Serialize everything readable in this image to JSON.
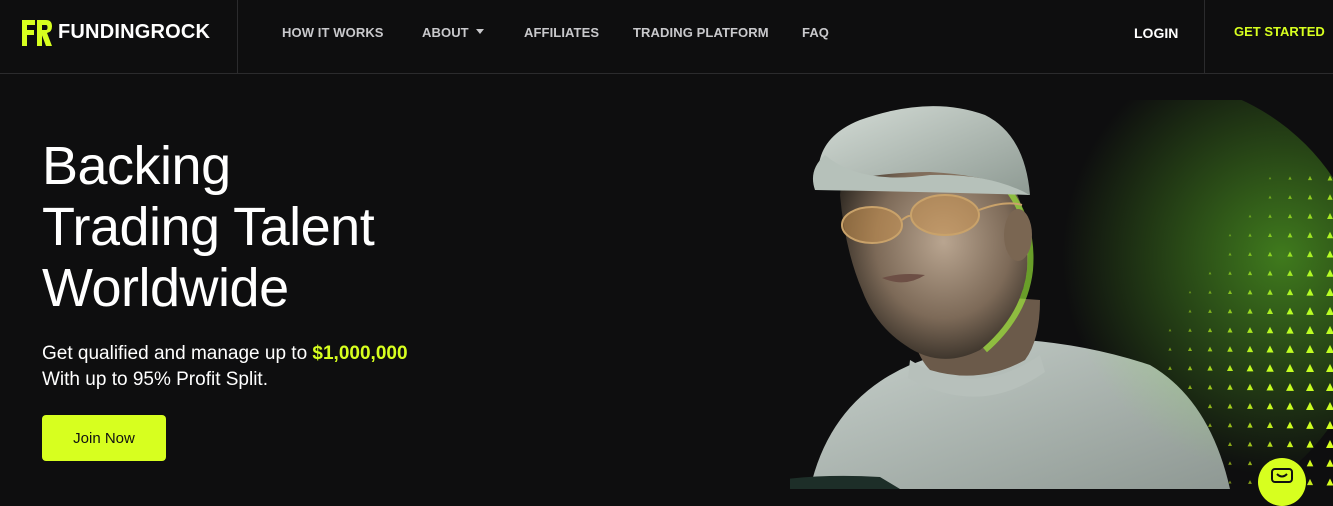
{
  "brand": {
    "name": "FUNDINGROCK",
    "logo_icon": "fr-logo-icon",
    "accent_color": "#d7ff1f"
  },
  "nav": {
    "links": [
      {
        "label": "HOW IT WORKS"
      },
      {
        "label": "ABOUT",
        "has_dropdown": true
      },
      {
        "label": "AFFILIATES"
      },
      {
        "label": "TRADING PLATFORM"
      },
      {
        "label": "FAQ"
      }
    ],
    "login": "LOGIN",
    "get_started": "GET STARTED"
  },
  "hero": {
    "title_lines": [
      "Backing",
      "Trading Talent",
      "Worldwide"
    ],
    "subtitle_prefix": "Get qualified and manage up to ",
    "subtitle_amount": "$1,000,000",
    "subtitle_line2": "With up to 95% Profit Split.",
    "cta": "Join Now"
  },
  "chat": {
    "icon": "chat-icon"
  }
}
